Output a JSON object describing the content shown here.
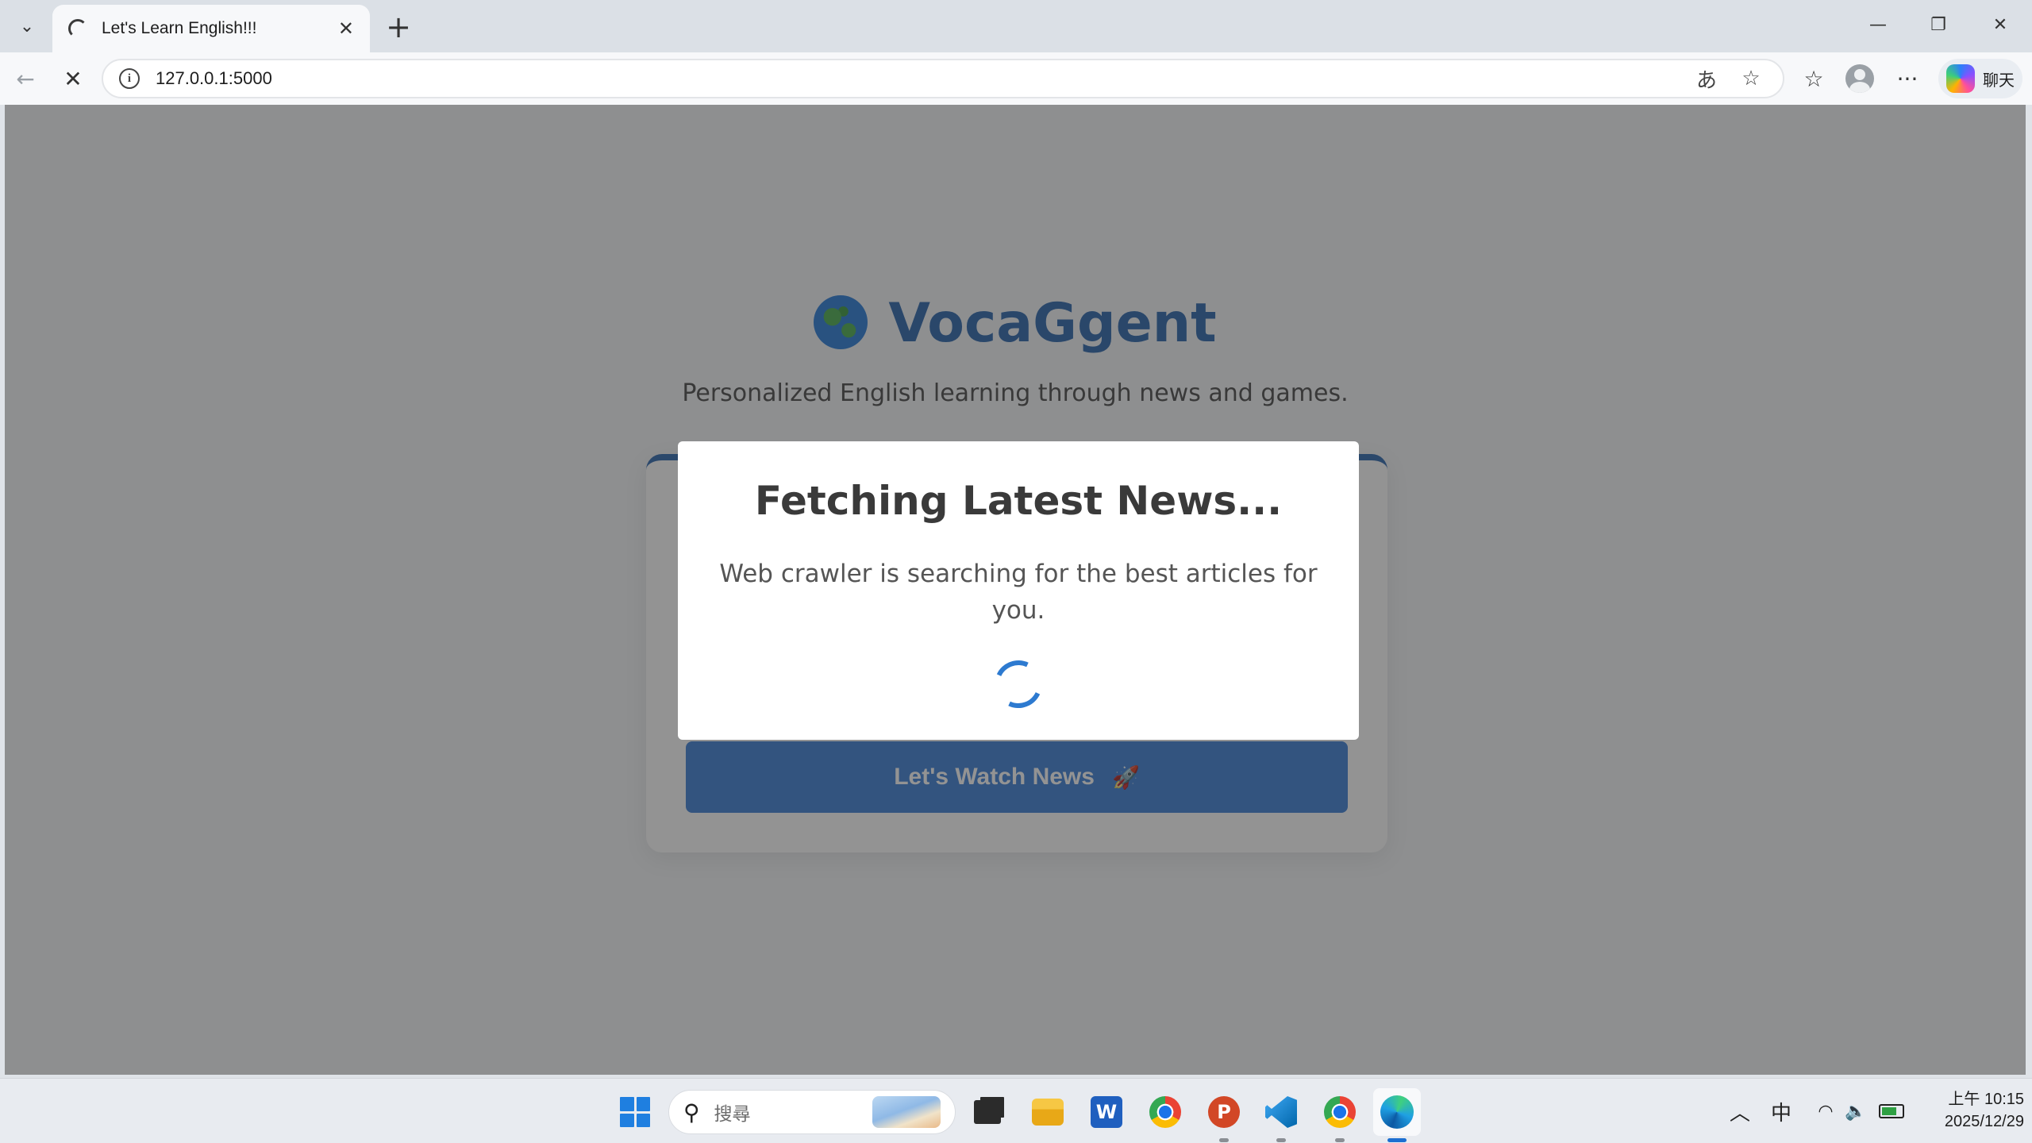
{
  "browser": {
    "tab_title": "Let's Learn English!!!",
    "url": "127.0.0.1:5000",
    "copilot_label": "聊天"
  },
  "page": {
    "brand": "VocaGgent",
    "subtitle": "Personalized English learning through news and games.",
    "cta_label": "Let's Watch News",
    "cta_icon": "🚀",
    "accent_color": "#2c66ad"
  },
  "modal": {
    "title": "Fetching Latest News...",
    "text": "Web crawler is searching for the best articles for you."
  },
  "taskbar": {
    "search_placeholder": "搜尋",
    "ime": "中",
    "time": "上午 10:15",
    "date": "2025/12/29"
  },
  "icons": {
    "brand_icon": "globe-icon",
    "loading": "spinner-icon"
  }
}
